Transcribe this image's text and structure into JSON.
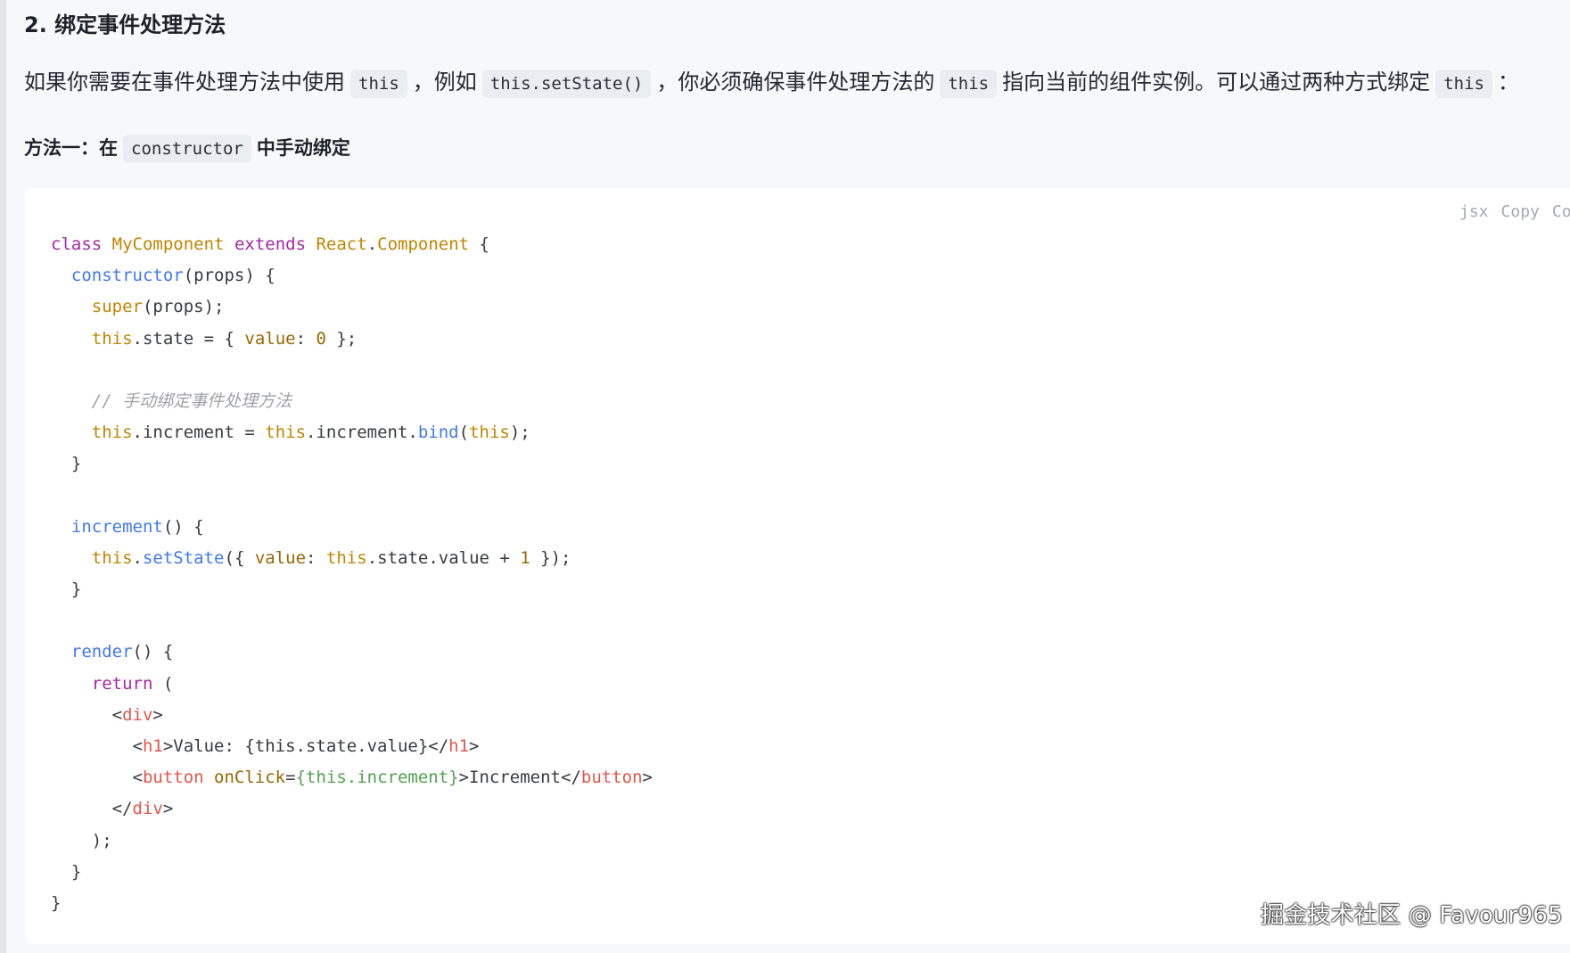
{
  "section": {
    "heading": "2. 绑定事件处理方法"
  },
  "paragraph": {
    "t1": "如果你需要在事件处理方法中使用",
    "c1": "this",
    "t2": "，例如",
    "c2": "this.setState()",
    "t3": "，你必须确保事件处理方法的",
    "c3": "this",
    "t4": "指向当前的组件实例。可以通过两种方式绑定",
    "c4": "this",
    "t5": "："
  },
  "method1": {
    "prefix": "方法一：在",
    "code": "constructor",
    "suffix": "中手动绑定"
  },
  "code_block": {
    "language": "jsx",
    "copy_label": "Copy",
    "copy_code_label": "Co",
    "lines": [
      [
        [
          "kw",
          "class"
        ],
        [
          "p",
          " "
        ],
        [
          "class",
          "MyComponent"
        ],
        [
          "p",
          " "
        ],
        [
          "kw",
          "extends"
        ],
        [
          "p",
          " "
        ],
        [
          "class",
          "React"
        ],
        [
          "p",
          "."
        ],
        [
          "class",
          "Component"
        ],
        [
          "p",
          " {"
        ]
      ],
      [
        [
          "p",
          "  "
        ],
        [
          "fn",
          "constructor"
        ],
        [
          "p",
          "(props) {"
        ]
      ],
      [
        [
          "p",
          "    "
        ],
        [
          "this",
          "super"
        ],
        [
          "p",
          "(props);"
        ]
      ],
      [
        [
          "p",
          "    "
        ],
        [
          "this",
          "this"
        ],
        [
          "p",
          ".state = { "
        ],
        [
          "prop",
          "value"
        ],
        [
          "p",
          ": "
        ],
        [
          "num",
          "0"
        ],
        [
          "p",
          " };"
        ]
      ],
      [],
      [
        [
          "p",
          "    "
        ],
        [
          "comment",
          "// 手动绑定事件处理方法"
        ]
      ],
      [
        [
          "p",
          "    "
        ],
        [
          "this",
          "this"
        ],
        [
          "p",
          ".increment = "
        ],
        [
          "this",
          "this"
        ],
        [
          "p",
          ".increment."
        ],
        [
          "fn",
          "bind"
        ],
        [
          "p",
          "("
        ],
        [
          "this",
          "this"
        ],
        [
          "p",
          ");"
        ]
      ],
      [
        [
          "p",
          "  }"
        ]
      ],
      [],
      [
        [
          "p",
          "  "
        ],
        [
          "fn",
          "increment"
        ],
        [
          "p",
          "() {"
        ]
      ],
      [
        [
          "p",
          "    "
        ],
        [
          "this",
          "this"
        ],
        [
          "p",
          "."
        ],
        [
          "fn",
          "setState"
        ],
        [
          "p",
          "({ "
        ],
        [
          "prop",
          "value"
        ],
        [
          "p",
          ": "
        ],
        [
          "this",
          "this"
        ],
        [
          "p",
          ".state.value + "
        ],
        [
          "num",
          "1"
        ],
        [
          "p",
          " });"
        ]
      ],
      [
        [
          "p",
          "  }"
        ]
      ],
      [],
      [
        [
          "p",
          "  "
        ],
        [
          "fn",
          "render"
        ],
        [
          "p",
          "() {"
        ]
      ],
      [
        [
          "p",
          "    "
        ],
        [
          "kw",
          "return"
        ],
        [
          "p",
          " ("
        ]
      ],
      [
        [
          "p",
          "      <"
        ],
        [
          "tag",
          "div"
        ],
        [
          "p",
          ">"
        ]
      ],
      [
        [
          "p",
          "        <"
        ],
        [
          "tag",
          "h1"
        ],
        [
          "p",
          ">Value: {this.state.value}</"
        ],
        [
          "tag",
          "h1"
        ],
        [
          "p",
          ">"
        ]
      ],
      [
        [
          "p",
          "        <"
        ],
        [
          "tag",
          "button"
        ],
        [
          "p",
          " "
        ],
        [
          "attr",
          "onClick"
        ],
        [
          "p",
          "="
        ],
        [
          "str",
          "{this.increment}"
        ],
        [
          "p",
          ">Increment</"
        ],
        [
          "tag",
          "button"
        ],
        [
          "p",
          ">"
        ]
      ],
      [
        [
          "p",
          "      </"
        ],
        [
          "tag",
          "div"
        ],
        [
          "p",
          ">"
        ]
      ],
      [
        [
          "p",
          "    );"
        ]
      ],
      [
        [
          "p",
          "  }"
        ]
      ],
      [
        [
          "p",
          "}"
        ]
      ]
    ]
  },
  "watermark": "掘金技术社区 @ Favour965",
  "colors": {
    "page_bg": "#f7f8fa",
    "code_bg": "#ffffff",
    "inline_code_bg": "#eaedf1",
    "keyword": "#a626a4",
    "class_name": "#c18401",
    "function": "#4078f2",
    "number": "#986801",
    "comment": "#a0a1a7",
    "tag": "#e45649",
    "string": "#50a14f"
  }
}
